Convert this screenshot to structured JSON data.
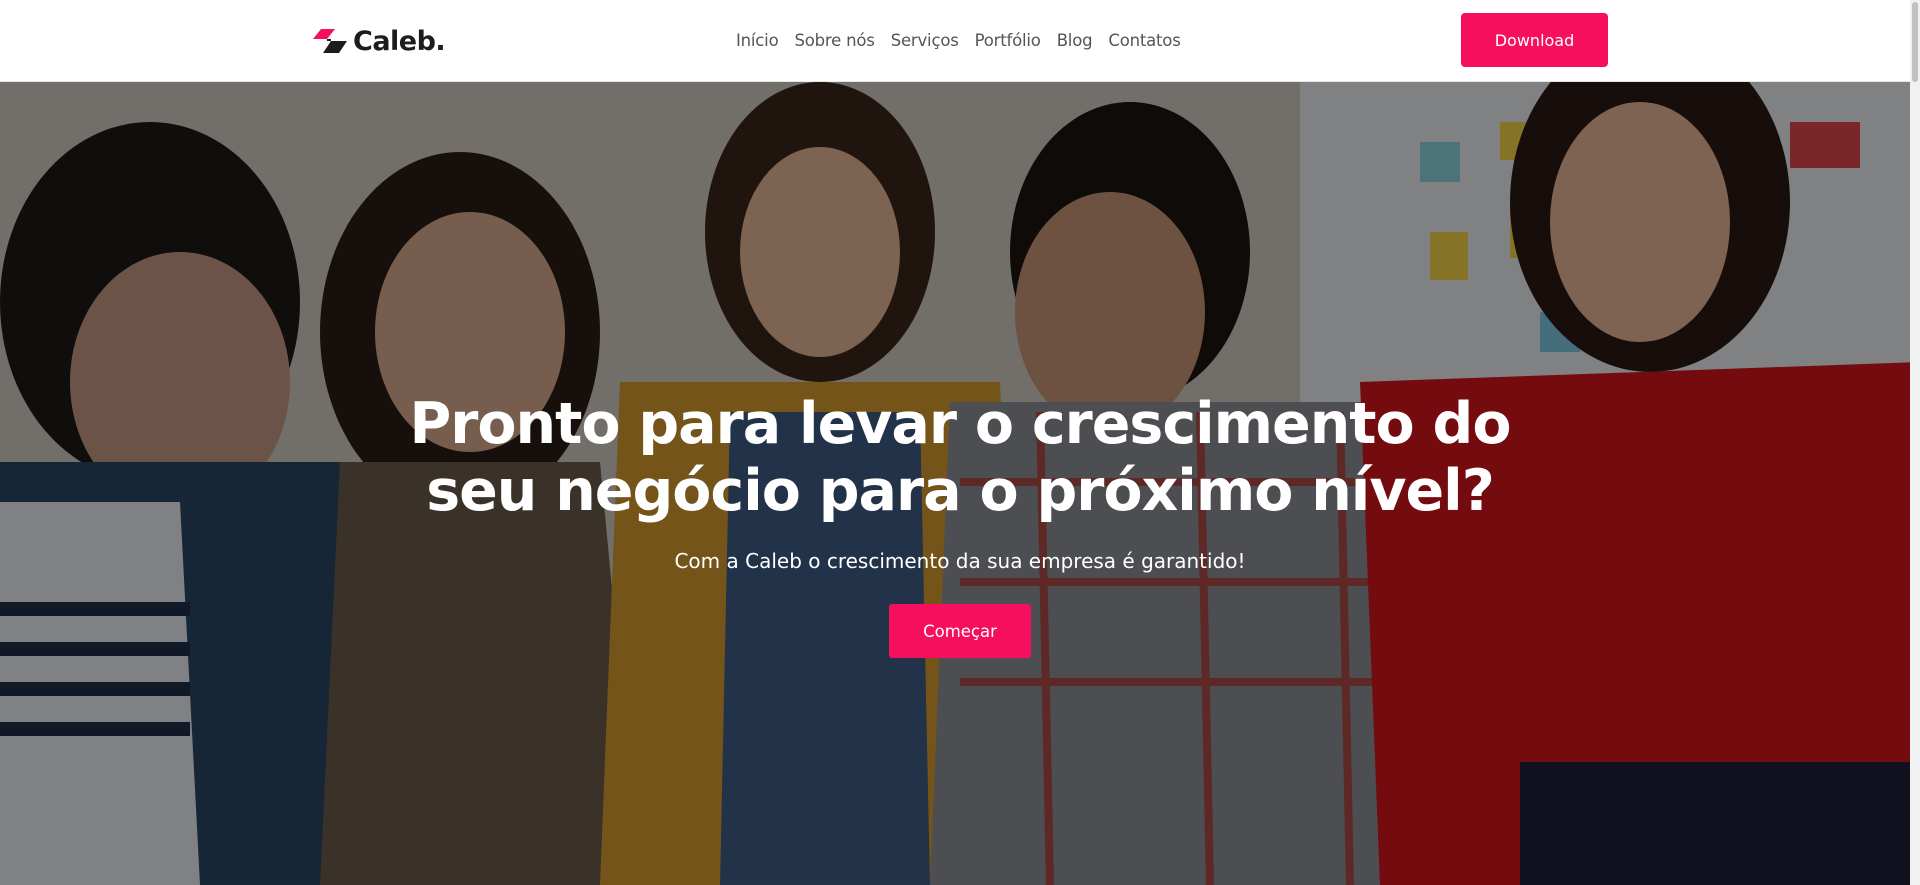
{
  "header": {
    "logo_text": "Caleb.",
    "nav": [
      {
        "label": "Início"
      },
      {
        "label": "Sobre nós"
      },
      {
        "label": "Serviços"
      },
      {
        "label": "Portfólio"
      },
      {
        "label": "Blog"
      },
      {
        "label": "Contatos"
      }
    ],
    "download_label": "Download"
  },
  "hero": {
    "title_line1": "Pronto para levar o crescimento do",
    "title_line2": "seu negócio para o próximo nível?",
    "subtitle": "Com a Caleb o crescimento da sua empresa é garantido!",
    "cta_label": "Começar",
    "image": "team-photo"
  },
  "colors": {
    "accent": "#f50f5c",
    "header_bg": "#ffffff",
    "nav_text": "#555555",
    "logo_text": "#1c1c1c"
  },
  "icons": [
    "logo-mark-icon"
  ]
}
